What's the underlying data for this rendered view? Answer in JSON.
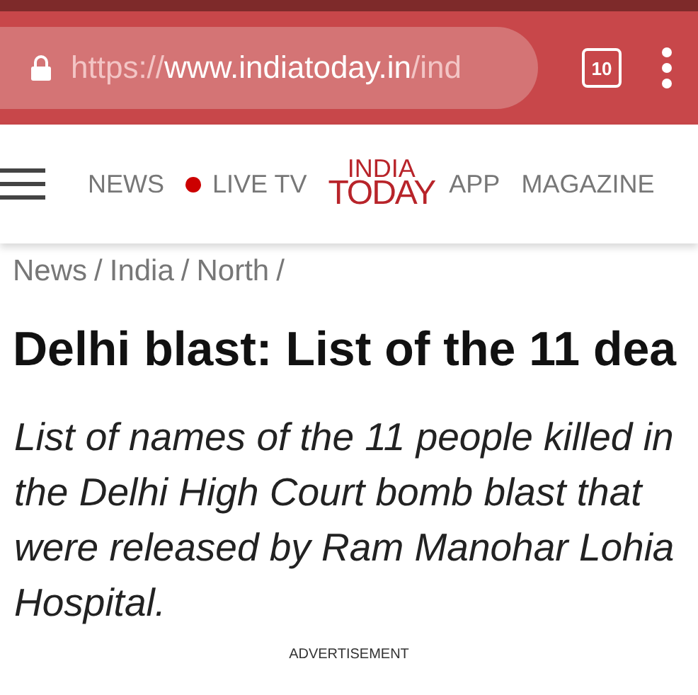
{
  "browser": {
    "url_scheme": "https://",
    "url_host": "www.indiatoday.in",
    "url_path": "/ind",
    "tab_count": "10"
  },
  "nav": {
    "items": [
      {
        "label": "NEWS",
        "kind": "link"
      },
      {
        "label": "LIVE TV",
        "kind": "live"
      },
      {
        "label": "INDIA",
        "kind": "logo_top"
      },
      {
        "label": "TODAY",
        "kind": "logo_bottom"
      },
      {
        "label": "APP",
        "kind": "link"
      },
      {
        "label": "MAGAZINE",
        "kind": "link"
      }
    ]
  },
  "breadcrumb": [
    {
      "label": "News",
      "separator": "/"
    },
    {
      "label": "India",
      "separator": "/"
    },
    {
      "label": "North",
      "separator": "/"
    }
  ],
  "article": {
    "headline": "Delhi blast: List of the 11 dea",
    "summary": "List of names of the 11 people killed in the Delhi High Court bomb blast that were released by Ram Manohar Lohia Hospital."
  },
  "ad_label": "ADVERTISEMENT"
}
